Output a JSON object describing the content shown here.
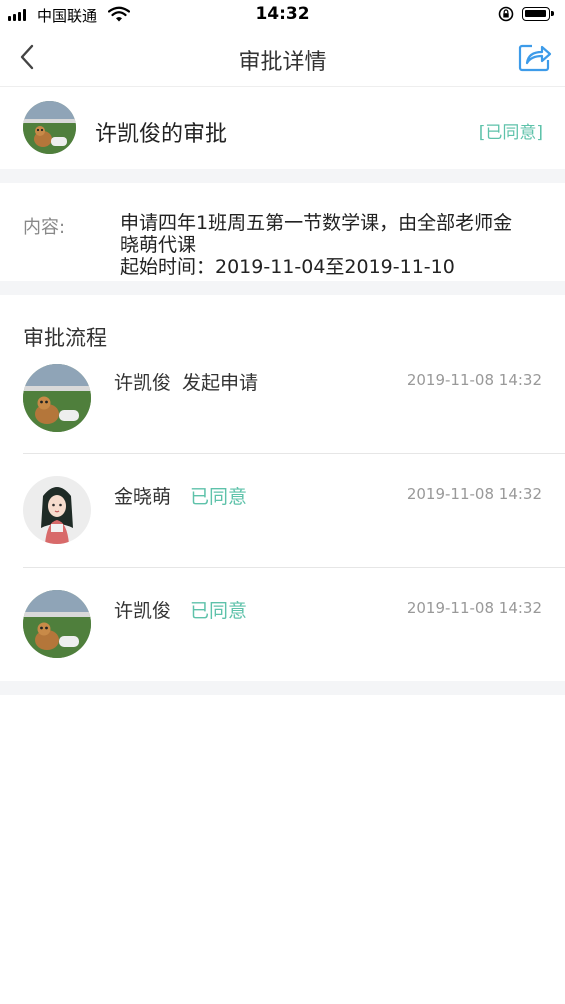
{
  "status_bar": {
    "carrier": "中国联通",
    "time": "14:32"
  },
  "nav": {
    "title": "审批详情",
    "back_icon": "chevron-left-icon",
    "share_icon": "share-icon"
  },
  "header": {
    "applicant_title": "许凯俊的审批",
    "status": "[已同意]"
  },
  "content": {
    "label": "内容:",
    "lines": [
      "申请四年1班周五第一节数学课，由全部老师金",
      "晓萌代课",
      "起始时间：2019-11-04至2019-11-10"
    ]
  },
  "flow": {
    "title": "审批流程",
    "steps": [
      {
        "name": "许凯俊",
        "action": "发起申请",
        "time": "2019-11-08 14:32"
      },
      {
        "name": "金晓萌",
        "action": "已同意",
        "time": "2019-11-08 14:32"
      },
      {
        "name": "许凯俊",
        "action": "已同意",
        "time": "2019-11-08 14:32"
      }
    ]
  },
  "colors": {
    "accent_green": "#5ec2aa",
    "share_blue": "#3d9be9",
    "divider": "#e6e6e6",
    "page_gap": "#f4f5f7"
  }
}
